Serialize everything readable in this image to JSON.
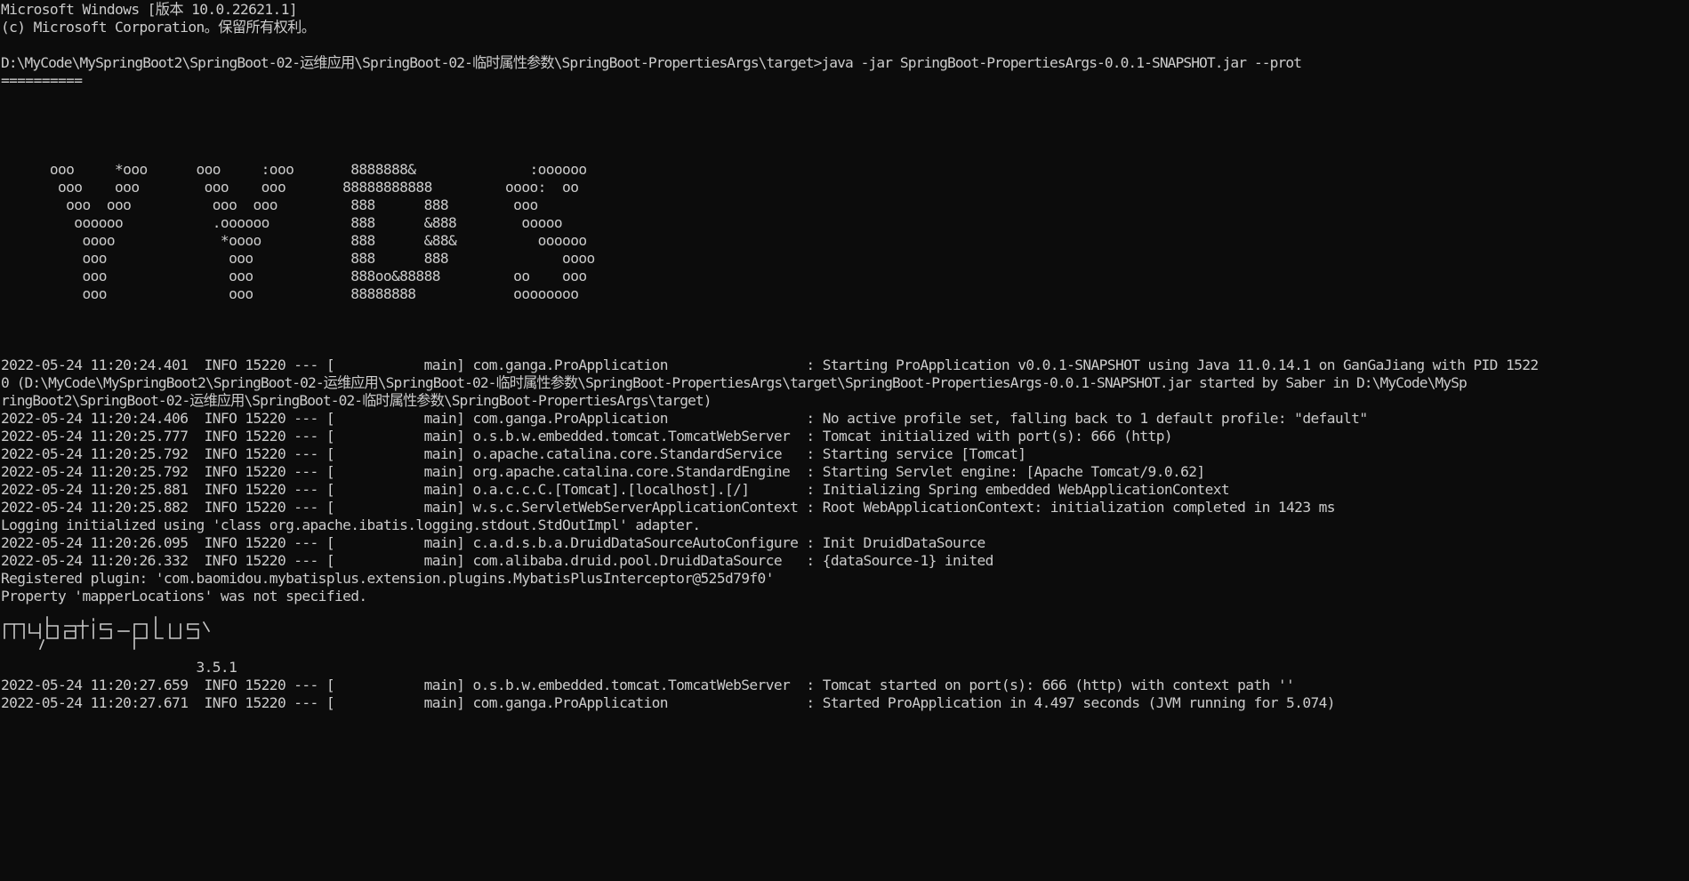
{
  "console": {
    "lines": [
      "Microsoft Windows [版本 10.0.22621.1]",
      "(c) Microsoft Corporation。保留所有权利。",
      "",
      "D:\\MyCode\\MySpringBoot2\\SpringBoot-02-运维应用\\SpringBoot-02-临时属性参数\\SpringBoot-PropertiesArgs\\target>java -jar SpringBoot-PropertiesArgs-0.0.1-SNAPSHOT.jar --prot",
      "==========",
      "",
      "",
      "",
      "",
      "      ooo     *ooo      ooo     :ooo       8888888&              :oooooo",
      "       ooo    ooo        ooo    ooo       88888888888         oooo:  oo",
      "        ooo  ooo          ooo  ooo         888      888        ooo",
      "         oooooo           .oooooo          888      &888        ooooo",
      "          oooo             *oooo           888      &88&          oooooo",
      "          ooo               ooo            888      888              oooo",
      "          ooo               ooo            888oo&88888         oo    ooo",
      "          ooo               ooo            88888888            oooooooo",
      "",
      "",
      "",
      "2022-05-24 11:20:24.401  INFO 15220 --- [           main] com.ganga.ProApplication                 : Starting ProApplication v0.0.1-SNAPSHOT using Java 11.0.14.1 on GanGaJiang with PID 1522",
      "0 (D:\\MyCode\\MySpringBoot2\\SpringBoot-02-运维应用\\SpringBoot-02-临时属性参数\\SpringBoot-PropertiesArgs\\target\\SpringBoot-PropertiesArgs-0.0.1-SNAPSHOT.jar started by Saber in D:\\MyCode\\MySp",
      "ringBoot2\\SpringBoot-02-运维应用\\SpringBoot-02-临时属性参数\\SpringBoot-PropertiesArgs\\target)",
      "2022-05-24 11:20:24.406  INFO 15220 --- [           main] com.ganga.ProApplication                 : No active profile set, falling back to 1 default profile: \"default\"",
      "2022-05-24 11:20:25.777  INFO 15220 --- [           main] o.s.b.w.embedded.tomcat.TomcatWebServer  : Tomcat initialized with port(s): 666 (http)",
      "2022-05-24 11:20:25.792  INFO 15220 --- [           main] o.apache.catalina.core.StandardService   : Starting service [Tomcat]",
      "2022-05-24 11:20:25.792  INFO 15220 --- [           main] org.apache.catalina.core.StandardEngine  : Starting Servlet engine: [Apache Tomcat/9.0.62]",
      "2022-05-24 11:20:25.881  INFO 15220 --- [           main] o.a.c.c.C.[Tomcat].[localhost].[/]       : Initializing Spring embedded WebApplicationContext",
      "2022-05-24 11:20:25.882  INFO 15220 --- [           main] w.s.c.ServletWebServerApplicationContext : Root WebApplicationContext: initialization completed in 1423 ms",
      "Logging initialized using 'class org.apache.ibatis.logging.stdout.StdOutImpl' adapter.",
      "2022-05-24 11:20:26.095  INFO 15220 --- [           main] c.a.d.s.b.a.DruidDataSourceAutoConfigure : Init DruidDataSource",
      "2022-05-24 11:20:26.332  INFO 15220 --- [           main] com.alibaba.druid.pool.DruidDataSource   : {dataSource-1} inited",
      "Registered plugin: 'com.baomidou.mybatisplus.extension.plugins.MybatisPlusInterceptor@525d79f0'",
      "Property 'mapperLocations' was not specified.",
      "",
      "",
      "",
      "                        3.5.1",
      "2022-05-24 11:20:27.659  INFO 15220 --- [           main] o.s.b.w.embedded.tomcat.TomcatWebServer  : Tomcat started on port(s): 666 (http) with context path ''",
      "2022-05-24 11:20:27.671  INFO 15220 --- [           main] com.ganga.ProApplication                 : Started ProApplication in 4.497 seconds (JVM running for 5.074)"
    ]
  },
  "colors": {
    "background": "#0c0c0c",
    "text": "#cccccc"
  },
  "icons": {
    "mybatis_plus_banner": "mybatis-plus-ascii-logo"
  }
}
